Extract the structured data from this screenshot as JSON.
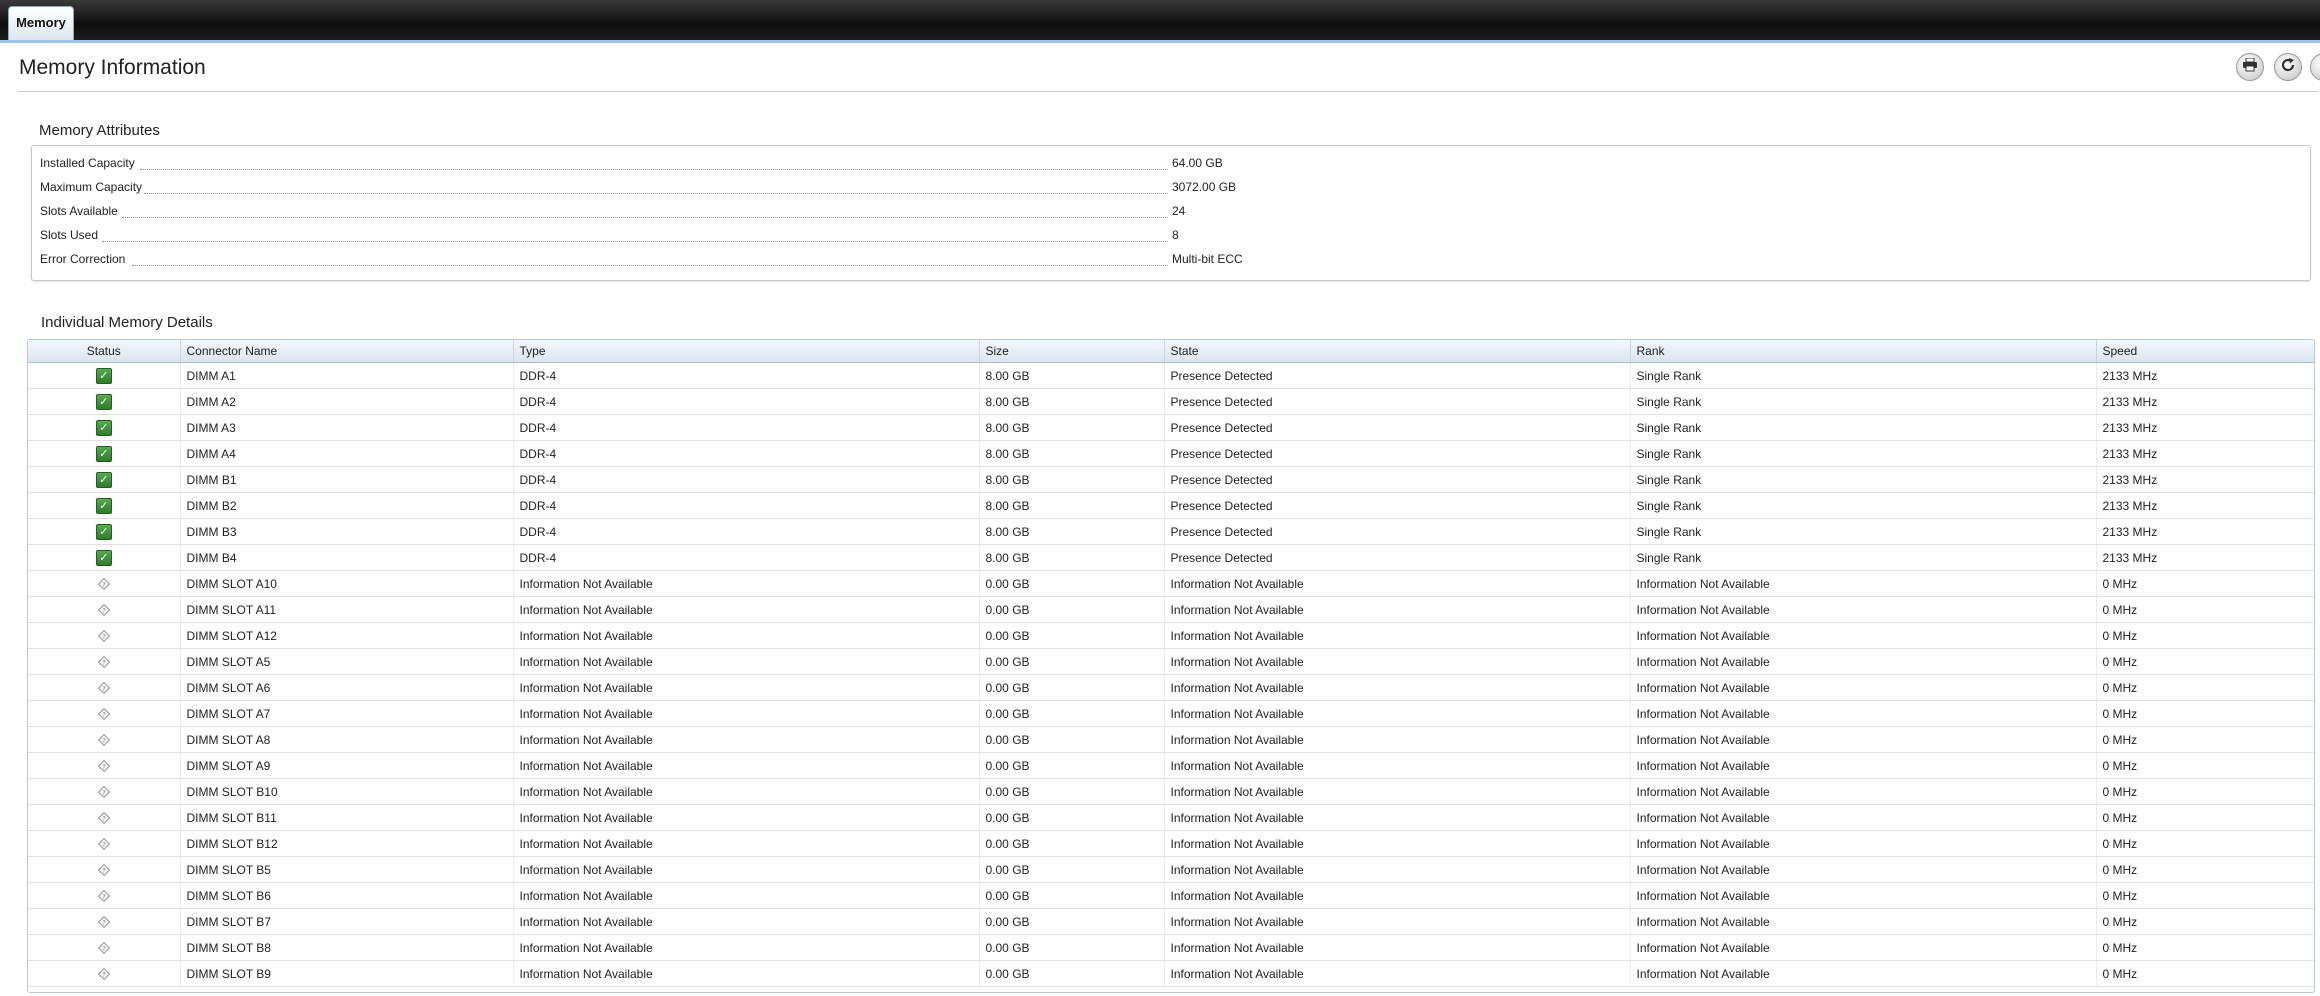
{
  "tabs": [
    {
      "label": "Memory",
      "active": true
    }
  ],
  "page": {
    "title": "Memory Information"
  },
  "toolbar": {
    "icons": [
      "print-icon",
      "refresh-icon",
      "help-icon"
    ]
  },
  "attributes": {
    "title": "Memory Attributes",
    "rows": [
      {
        "label": "Installed Capacity",
        "value": "64.00 GB"
      },
      {
        "label": "Maximum Capacity",
        "value": "3072.00 GB"
      },
      {
        "label": "Slots Available",
        "value": "24"
      },
      {
        "label": "Slots Used",
        "value": "8"
      },
      {
        "label": "Error Correction",
        "value": "Multi-bit ECC"
      }
    ]
  },
  "details": {
    "title": "Individual Memory Details",
    "columns": [
      "Status",
      "Connector Name",
      "Type",
      "Size",
      "State",
      "Rank",
      "Speed"
    ],
    "rows": [
      {
        "status": "ok",
        "connector": "DIMM A1",
        "type": "DDR-4",
        "size": "8.00 GB",
        "state": "Presence Detected",
        "rank": "Single Rank",
        "speed": "2133 MHz"
      },
      {
        "status": "ok",
        "connector": "DIMM A2",
        "type": "DDR-4",
        "size": "8.00 GB",
        "state": "Presence Detected",
        "rank": "Single Rank",
        "speed": "2133 MHz"
      },
      {
        "status": "ok",
        "connector": "DIMM A3",
        "type": "DDR-4",
        "size": "8.00 GB",
        "state": "Presence Detected",
        "rank": "Single Rank",
        "speed": "2133 MHz"
      },
      {
        "status": "ok",
        "connector": "DIMM A4",
        "type": "DDR-4",
        "size": "8.00 GB",
        "state": "Presence Detected",
        "rank": "Single Rank",
        "speed": "2133 MHz"
      },
      {
        "status": "ok",
        "connector": "DIMM B1",
        "type": "DDR-4",
        "size": "8.00 GB",
        "state": "Presence Detected",
        "rank": "Single Rank",
        "speed": "2133 MHz"
      },
      {
        "status": "ok",
        "connector": "DIMM B2",
        "type": "DDR-4",
        "size": "8.00 GB",
        "state": "Presence Detected",
        "rank": "Single Rank",
        "speed": "2133 MHz"
      },
      {
        "status": "ok",
        "connector": "DIMM B3",
        "type": "DDR-4",
        "size": "8.00 GB",
        "state": "Presence Detected",
        "rank": "Single Rank",
        "speed": "2133 MHz"
      },
      {
        "status": "ok",
        "connector": "DIMM B4",
        "type": "DDR-4",
        "size": "8.00 GB",
        "state": "Presence Detected",
        "rank": "Single Rank",
        "speed": "2133 MHz"
      },
      {
        "status": "unknown",
        "connector": "DIMM SLOT A10",
        "type": "Information Not Available",
        "size": "0.00 GB",
        "state": "Information Not Available",
        "rank": "Information Not Available",
        "speed": "0 MHz"
      },
      {
        "status": "unknown",
        "connector": "DIMM SLOT A11",
        "type": "Information Not Available",
        "size": "0.00 GB",
        "state": "Information Not Available",
        "rank": "Information Not Available",
        "speed": "0 MHz"
      },
      {
        "status": "unknown",
        "connector": "DIMM SLOT A12",
        "type": "Information Not Available",
        "size": "0.00 GB",
        "state": "Information Not Available",
        "rank": "Information Not Available",
        "speed": "0 MHz"
      },
      {
        "status": "unknown",
        "connector": "DIMM SLOT A5",
        "type": "Information Not Available",
        "size": "0.00 GB",
        "state": "Information Not Available",
        "rank": "Information Not Available",
        "speed": "0 MHz"
      },
      {
        "status": "unknown",
        "connector": "DIMM SLOT A6",
        "type": "Information Not Available",
        "size": "0.00 GB",
        "state": "Information Not Available",
        "rank": "Information Not Available",
        "speed": "0 MHz"
      },
      {
        "status": "unknown",
        "connector": "DIMM SLOT A7",
        "type": "Information Not Available",
        "size": "0.00 GB",
        "state": "Information Not Available",
        "rank": "Information Not Available",
        "speed": "0 MHz"
      },
      {
        "status": "unknown",
        "connector": "DIMM SLOT A8",
        "type": "Information Not Available",
        "size": "0.00 GB",
        "state": "Information Not Available",
        "rank": "Information Not Available",
        "speed": "0 MHz"
      },
      {
        "status": "unknown",
        "connector": "DIMM SLOT A9",
        "type": "Information Not Available",
        "size": "0.00 GB",
        "state": "Information Not Available",
        "rank": "Information Not Available",
        "speed": "0 MHz"
      },
      {
        "status": "unknown",
        "connector": "DIMM SLOT B10",
        "type": "Information Not Available",
        "size": "0.00 GB",
        "state": "Information Not Available",
        "rank": "Information Not Available",
        "speed": "0 MHz"
      },
      {
        "status": "unknown",
        "connector": "DIMM SLOT B11",
        "type": "Information Not Available",
        "size": "0.00 GB",
        "state": "Information Not Available",
        "rank": "Information Not Available",
        "speed": "0 MHz"
      },
      {
        "status": "unknown",
        "connector": "DIMM SLOT B12",
        "type": "Information Not Available",
        "size": "0.00 GB",
        "state": "Information Not Available",
        "rank": "Information Not Available",
        "speed": "0 MHz"
      },
      {
        "status": "unknown",
        "connector": "DIMM SLOT B5",
        "type": "Information Not Available",
        "size": "0.00 GB",
        "state": "Information Not Available",
        "rank": "Information Not Available",
        "speed": "0 MHz"
      },
      {
        "status": "unknown",
        "connector": "DIMM SLOT B6",
        "type": "Information Not Available",
        "size": "0.00 GB",
        "state": "Information Not Available",
        "rank": "Information Not Available",
        "speed": "0 MHz"
      },
      {
        "status": "unknown",
        "connector": "DIMM SLOT B7",
        "type": "Information Not Available",
        "size": "0.00 GB",
        "state": "Information Not Available",
        "rank": "Information Not Available",
        "speed": "0 MHz"
      },
      {
        "status": "unknown",
        "connector": "DIMM SLOT B8",
        "type": "Information Not Available",
        "size": "0.00 GB",
        "state": "Information Not Available",
        "rank": "Information Not Available",
        "speed": "0 MHz"
      },
      {
        "status": "unknown",
        "connector": "DIMM SLOT B9",
        "type": "Information Not Available",
        "size": "0.00 GB",
        "state": "Information Not Available",
        "rank": "Information Not Available",
        "speed": "0 MHz"
      }
    ]
  }
}
